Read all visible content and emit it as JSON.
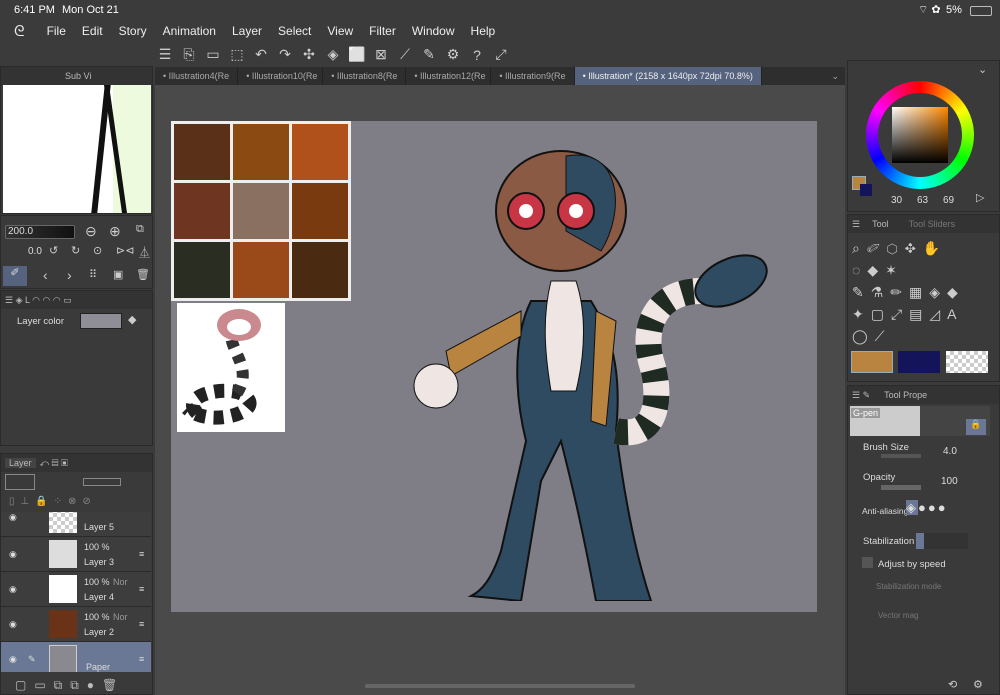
{
  "status": {
    "time": "6:41 PM",
    "date": "Mon Oct 21",
    "battery": "5%"
  },
  "menu": [
    "File",
    "Edit",
    "Story",
    "Animation",
    "Layer",
    "Select",
    "View",
    "Filter",
    "Window",
    "Help"
  ],
  "tabs": [
    "Illustration4(Re",
    "Illustration10(Re",
    "Illustration8(Re",
    "Illustration12(Re",
    "Illustration9(Re",
    "Illustration* (2158 x 1640px 72dpi 70.8%)"
  ],
  "subview": {
    "title": "Sub Vi"
  },
  "navigator": {
    "zoom": "200.0",
    "angle": "0.0"
  },
  "layer_property": {
    "layer_color_label": "Layer color",
    "layer_color": "#8f8e96"
  },
  "layer_panel": {
    "tab": "Layer",
    "layers": [
      {
        "name": "Layer 5",
        "opacity": "",
        "mode": ""
      },
      {
        "name": "Layer 3",
        "opacity": "100 %",
        "mode": ""
      },
      {
        "name": "Layer 4",
        "opacity": "100 %",
        "mode": "Nor"
      },
      {
        "name": "Layer 2",
        "opacity": "100 %",
        "mode": "Nor"
      },
      {
        "name": "Paper",
        "opacity": "",
        "mode": ""
      }
    ]
  },
  "color": {
    "main": "#b98440",
    "sub": "#14145a",
    "h": "30",
    "s": "63",
    "v": "69"
  },
  "tool_panel": {
    "tab_tool": "Tool",
    "tab_sliders": "Tool Sliders",
    "swatches": [
      "#b98440",
      "#14145a",
      "transparent"
    ]
  },
  "tool_property": {
    "tab": "Tool Prope",
    "brush": "G-pen",
    "brush_size_label": "Brush Size",
    "brush_size": "4.0",
    "opacity_label": "Opacity",
    "opacity": "100",
    "antialias_label": "Anti-aliasing",
    "stabilization_label": "Stabilization",
    "adjust_speed_label": "Adjust by speed",
    "stab_mode_label": "Stabilization mode",
    "vector_label": "Vector mag"
  },
  "colors": {
    "accent": "#6a7896",
    "paper": "#7f7e86"
  }
}
